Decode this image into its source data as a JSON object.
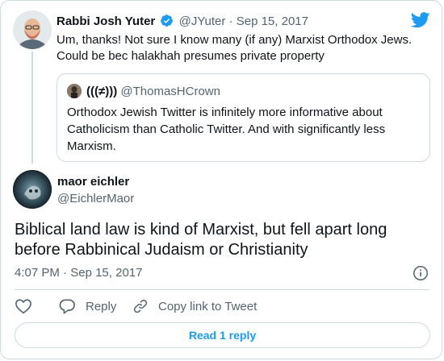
{
  "parent": {
    "name": "Rabbi Josh Yuter",
    "handle": "@JYuter",
    "sep": "·",
    "date": "Sep 15, 2017",
    "text": "Um, thanks! Not sure I know many (if any) Marxist Orthodox Jews. Could be bec halakhah presumes private property",
    "verified": true
  },
  "quote": {
    "name": "(((≠)))",
    "handle": "@ThomasHCrown",
    "text": "Orthodox Jewish Twitter is infinitely more informative about Catholicism than Catholic Twitter. And with significantly less Marxism."
  },
  "main": {
    "name": "maor eichler",
    "handle": "@EichlerMaor",
    "text": "Biblical land law is kind of Marxist, but fell apart long before Rabbinical Judaism or Christianity",
    "time": "4:07 PM",
    "sep": "·",
    "date": "Sep 15, 2017"
  },
  "actions": {
    "reply": "Reply",
    "copy_link": "Copy link to Tweet",
    "read_replies": "Read 1 reply"
  },
  "colors": {
    "accent": "#1d9bf0",
    "muted": "#536471",
    "border": "#cfd9de"
  }
}
